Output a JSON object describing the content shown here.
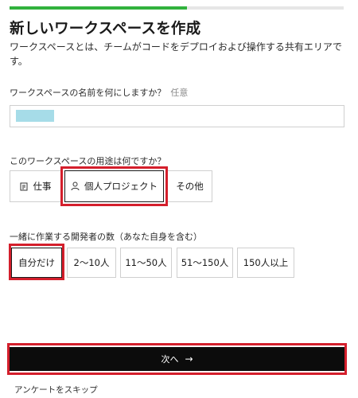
{
  "progress": {
    "fraction": 0.53
  },
  "header": {
    "title": "新しいワークスペースを作成",
    "description": "ワークスペースとは、チームがコードをデプロイおよび操作する共有エリアです。"
  },
  "name_field": {
    "label": "ワークスペースの名前を何にしますか？",
    "optional": "任意"
  },
  "purpose": {
    "label": "このワークスペースの用途は何ですか？",
    "options": [
      {
        "label": "仕事",
        "icon": "briefcase-icon"
      },
      {
        "label": "個人プロジェクト",
        "icon": "person-icon"
      },
      {
        "label": "その他"
      }
    ],
    "selected": "個人プロジェクト"
  },
  "team_size": {
    "label": "一緒に作業する開発者の数（あなた自身を含む）",
    "options": [
      "自分だけ",
      "2〜10人",
      "11〜50人",
      "51〜150人",
      "150人以上"
    ],
    "selected": "自分だけ"
  },
  "actions": {
    "next_label": "次へ",
    "next_arrow": "→",
    "skip_label": "アンケートをスキップ"
  },
  "colors": {
    "progress": "#31b23d",
    "highlight": "#d41f2c",
    "primary_button": "#0c0c0c"
  }
}
